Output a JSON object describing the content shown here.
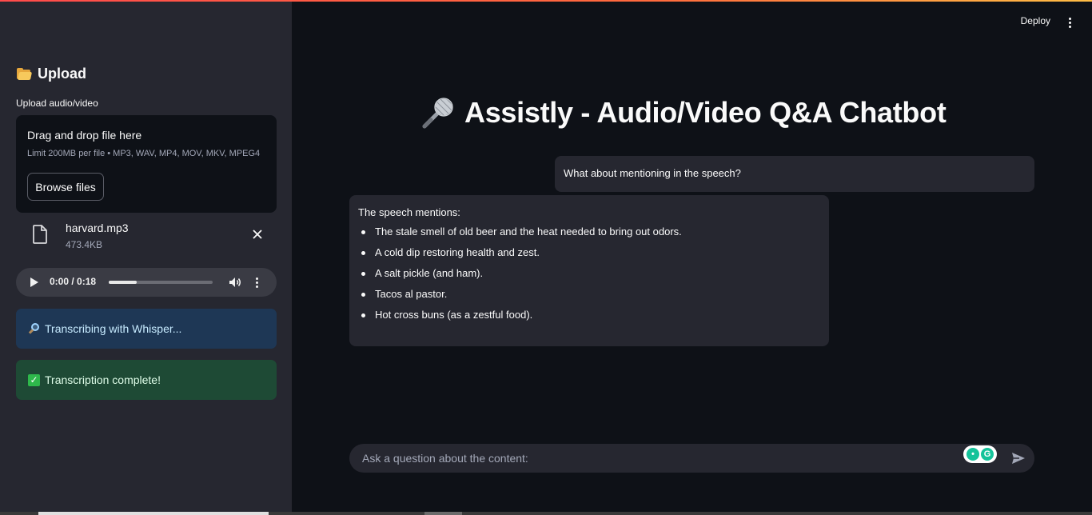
{
  "sidebar": {
    "title": "Upload",
    "title_icon": "folder-icon",
    "uploader_label": "Upload audio/video",
    "dropzone": {
      "title": "Drag and drop file here",
      "limit": "Limit 200MB per file • MP3, WAV, MP4, MOV, MKV, MPEG4",
      "browse_label": "Browse files"
    },
    "file": {
      "name": "harvard.mp3",
      "size": "473.4KB"
    },
    "audio": {
      "time": "0:00 / 0:18",
      "progress_fraction": 0.27
    },
    "alerts": {
      "info": "Transcribing with Whisper...",
      "success": "Transcription complete!"
    }
  },
  "header": {
    "deploy_label": "Deploy"
  },
  "main": {
    "title": "Assistly - Audio/Video Q&A Chatbot",
    "title_icon": "microphone-icon",
    "messages": [
      {
        "role": "user",
        "text": "What about mentioning in the speech?"
      },
      {
        "role": "assistant",
        "intro": "The speech mentions:",
        "items": [
          "The stale smell of old beer and the heat needed to bring out odors.",
          "A cold dip restoring health and zest.",
          "A salt pickle (and ham).",
          "Tacos al pastor.",
          "Hot cross buns (as a zestful food)."
        ]
      }
    ],
    "chat_input": {
      "placeholder": "Ask a question about the content:",
      "value": ""
    }
  },
  "colors": {
    "accent_gradient_start": "#ff4b4b",
    "accent_gradient_end": "#ffbd45",
    "sidebar_bg": "#262730",
    "main_bg": "#0e1117",
    "info_bg": "#1e3755",
    "success_bg": "#1e4a35"
  }
}
